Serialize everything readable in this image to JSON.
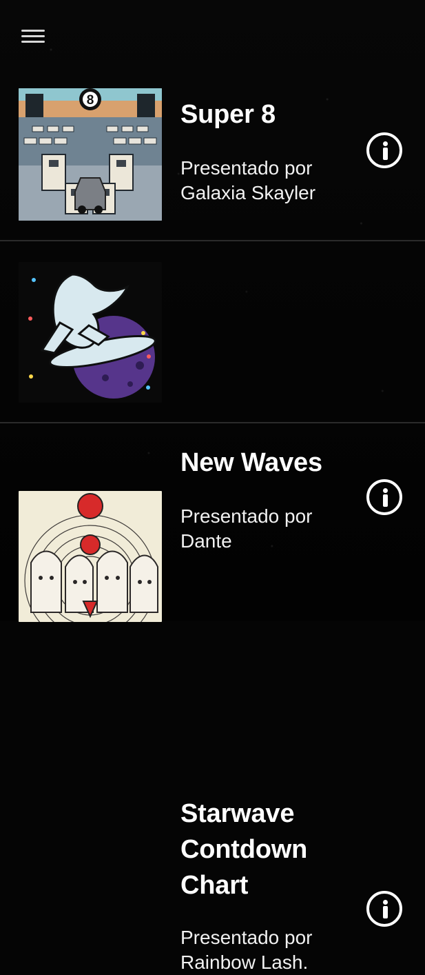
{
  "topbar": {
    "menu_icon": "hamburger-menu-icon"
  },
  "stations": [
    {
      "title": "Super 8",
      "subtitle": "Presentado por Galaxia Skayler",
      "info_icon": "info-icon",
      "art_name": "super-8-artwork"
    },
    {
      "title": "New Waves",
      "subtitle": "Presentado por Dante",
      "info_icon": "info-icon",
      "art_name": "new-waves-artwork"
    },
    {
      "title": "Starwave Contdown Chart",
      "subtitle": "Presentado por Rainbow Lash.",
      "info_icon": "info-icon",
      "art_name": "starwave-contdown-chart-artwork"
    }
  ],
  "colors": {
    "background": "#050505",
    "text": "#ffffff",
    "divider": "#2b2b2b"
  }
}
